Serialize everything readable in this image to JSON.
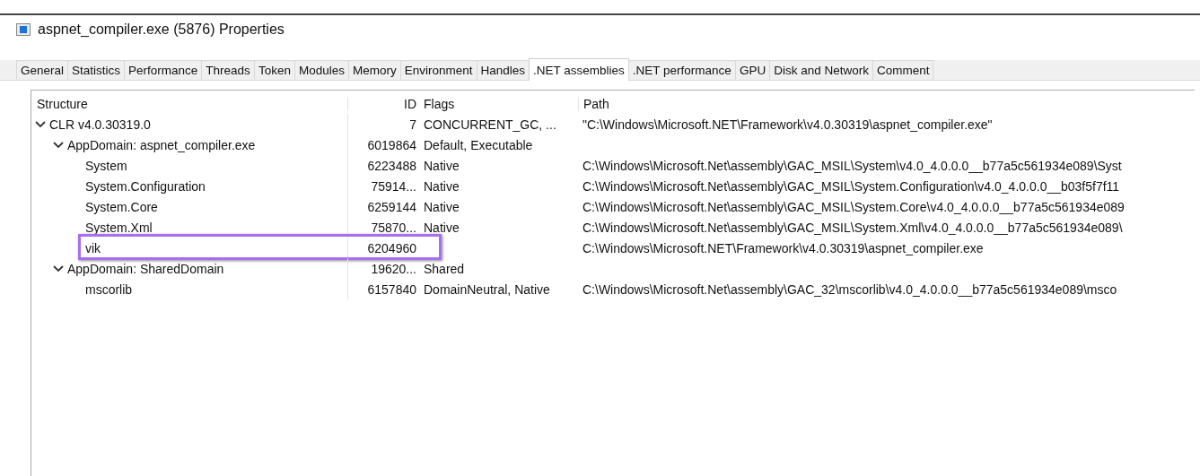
{
  "window": {
    "title": "aspnet_compiler.exe (5876) Properties"
  },
  "tabs": [
    {
      "label": "General",
      "selected": false
    },
    {
      "label": "Statistics",
      "selected": false
    },
    {
      "label": "Performance",
      "selected": false
    },
    {
      "label": "Threads",
      "selected": false
    },
    {
      "label": "Token",
      "selected": false
    },
    {
      "label": "Modules",
      "selected": false
    },
    {
      "label": "Memory",
      "selected": false
    },
    {
      "label": "Environment",
      "selected": false
    },
    {
      "label": "Handles",
      "selected": false
    },
    {
      "label": ".NET assemblies",
      "selected": true
    },
    {
      "label": ".NET performance",
      "selected": false
    },
    {
      "label": "GPU",
      "selected": false
    },
    {
      "label": "Disk and Network",
      "selected": false
    },
    {
      "label": "Comment",
      "selected": false
    }
  ],
  "tree": {
    "columns": [
      "Structure",
      "ID",
      "Flags",
      "Path"
    ],
    "rows": [
      {
        "structure": "CLR v4.0.30319.0",
        "id": "7",
        "flags": "CONCURRENT_GC, ...",
        "path": "\"C:\\Windows\\Microsoft.NET\\Framework\\v4.0.30319\\aspnet_compiler.exe\"",
        "expanded": true,
        "highlighted": false,
        "children": [
          {
            "structure": "AppDomain: aspnet_compiler.exe",
            "id": "6019864",
            "flags": "Default, Executable",
            "expanded": true,
            "highlighted": false,
            "children": [
              {
                "structure": "System",
                "id": "6223488",
                "flags": "Native",
                "path": "C:\\Windows\\Microsoft.Net\\assembly\\GAC_MSIL\\System\\v4.0_4.0.0.0__b77a5c561934e089\\Syst",
                "highlighted": false
              },
              {
                "structure": "System.Configuration",
                "id": "75914...",
                "flags": "Native",
                "path": "C:\\Windows\\Microsoft.Net\\assembly\\GAC_MSIL\\System.Configuration\\v4.0_4.0.0.0__b03f5f7f11",
                "highlighted": false
              },
              {
                "structure": "System.Core",
                "id": "6259144",
                "flags": "Native",
                "path": "C:\\Windows\\Microsoft.Net\\assembly\\GAC_MSIL\\System.Core\\v4.0_4.0.0.0__b77a5c561934e089",
                "highlighted": false
              },
              {
                "structure": "System.Xml",
                "id": "75870...",
                "flags": "Native",
                "path": "C:\\Windows\\Microsoft.Net\\assembly\\GAC_MSIL\\System.Xml\\v4.0_4.0.0.0__b77a5c561934e089\\",
                "highlighted": false
              },
              {
                "structure": "vik",
                "id": "6204960",
                "path": "C:\\Windows\\Microsoft.NET\\Framework\\v4.0.30319\\aspnet_compiler.exe",
                "highlighted": true
              }
            ]
          },
          {
            "structure": "AppDomain: SharedDomain",
            "id": "19620...",
            "flags": "Shared",
            "expanded": true,
            "highlighted": false,
            "children": [
              {
                "structure": "mscorlib",
                "id": "6157840",
                "flags": "DomainNeutral, Native",
                "path": "C:\\Windows\\Microsoft.Net\\assembly\\GAC_32\\mscorlib\\v4.0_4.0.0.0__b77a5c561934e089\\msco",
                "highlighted": false
              }
            ]
          }
        ]
      }
    ]
  }
}
